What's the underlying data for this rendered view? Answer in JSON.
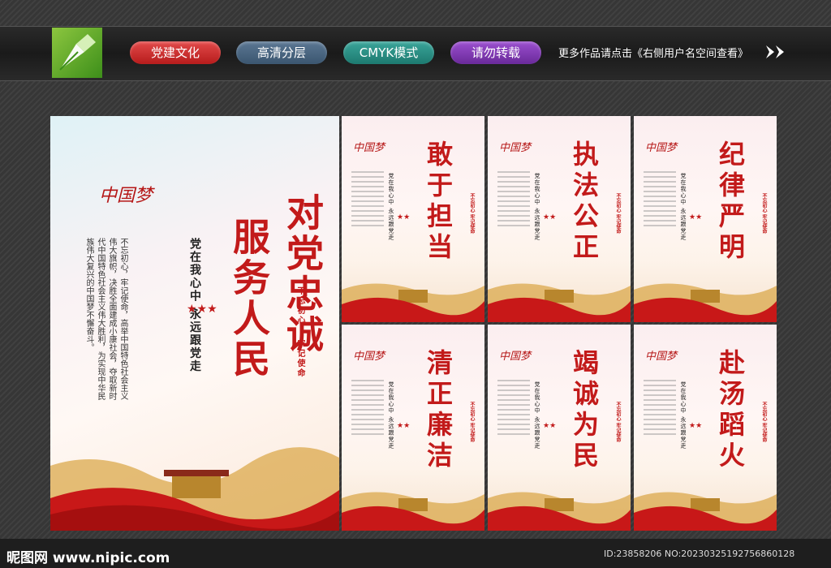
{
  "header": {
    "tags": [
      "党建文化",
      "高清分层",
      "CMYK模式",
      "请勿转载"
    ],
    "more_text": "更多作品请点击《右侧用户名空间查看》"
  },
  "main_poster": {
    "title_right": "对党忠诚",
    "title_left": "服务人民",
    "slogan": "党在我心中  永远跟党走",
    "body": "不忘初心，牢记使命，高举中国特色社会主义伟大旗帜，决胜全面建成小康社会，夺取新时代中国特色社会主义伟大胜利，为实现中华民族伟大复兴的中国梦不懈奋斗。",
    "seal_top": "不忘初心",
    "seal_bottom": "牢记使命",
    "script_text": "中国梦"
  },
  "small_posters": [
    {
      "title": "敢于担当",
      "slogan": "党在我心中 永远跟党走",
      "seal": "不忘初心 牢记使命"
    },
    {
      "title": "执法公正",
      "slogan": "党在我心中 永远跟党走",
      "seal": "不忘初心 牢记使命"
    },
    {
      "title": "纪律严明",
      "slogan": "党在我心中 永远跟党走",
      "seal": "不忘初心 牢记使命"
    },
    {
      "title": "清正廉洁",
      "slogan": "党在我心中 永远跟党走",
      "seal": "不忘初心 牢记使命"
    },
    {
      "title": "竭诚为民",
      "slogan": "党在我心中 永远跟党走",
      "seal": "不忘初心 牢记使命"
    },
    {
      "title": "赴汤蹈火",
      "slogan": "党在我心中 永远跟党走",
      "seal": "不忘初心 牢记使命"
    }
  ],
  "footer": {
    "site": "昵图网 www.nipic.com",
    "id_text": "ID:23858206 NO:20230325192756860128"
  },
  "colors": {
    "accent_red": "#c21a1a",
    "gold": "#d9a441"
  }
}
